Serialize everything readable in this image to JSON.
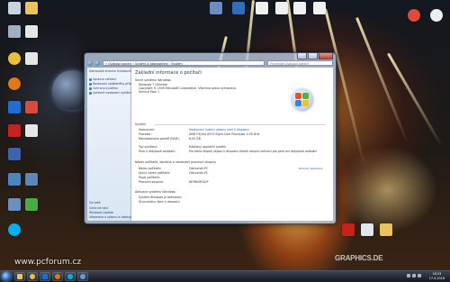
{
  "desktop": {
    "left_icons": [
      {
        "label": "Počítač",
        "color": "#c9d3df"
      },
      {
        "label": "Koš",
        "color": "#9fb0c4"
      },
      {
        "label": "Google Chrome",
        "color": "#e8c13a"
      },
      {
        "label": "Avast",
        "color": "#e0781c"
      },
      {
        "label": "Windows Media Player",
        "color": "#1d6ed8"
      },
      {
        "label": "CyberLink PowerDVD",
        "color": "#3a64b0"
      },
      {
        "label": "Adobe Reader",
        "color": "#c8221c"
      },
      {
        "label": "Network",
        "color": "#4b86c4"
      },
      {
        "label": "Remote",
        "color": "#6a90c0"
      },
      {
        "label": "Skype",
        "color": "#00aff0"
      }
    ],
    "right_icons": [
      {
        "label": "Folder",
        "color": "#e9c35d"
      },
      {
        "label": "Notes",
        "color": "#f0f0f0"
      },
      {
        "label": "Shortcut",
        "color": "#6a8ec4"
      },
      {
        "label": "Document",
        "color": "#f4f4f4"
      }
    ],
    "bottom_icons": [
      {
        "label": "Acrobat",
        "color": "#c8221c"
      },
      {
        "label": "Tool",
        "color": "#dfe6ee"
      },
      {
        "label": "Folder",
        "color": "#e9c35d"
      }
    ]
  },
  "window": {
    "address": "« Ovládací panely › Systém a zabezpečení › Systém",
    "search_placeholder": "Prohledat Ovládací panely",
    "left_pane": [
      "Domovská stránka Ovládacích panelů",
      "Správce zařízení",
      "Nastavení vzdáleného přístupu",
      "Ochrana systému",
      "Upřesnit nastavení systému"
    ],
    "left_pane_bottom_head": "Viz také",
    "left_pane_bottom": [
      "Centrum akcí",
      "Windows Update",
      "Informace o výkonu a nástroje"
    ],
    "title": "Základní informace o počítači",
    "edition_head": "Verze systému Windows",
    "edition": [
      "Windows 7 Ultimate",
      "Copyright © 2009 Microsoft Corporation. Všechna práva vyhrazena.",
      "Service Pack 1"
    ],
    "system_head": "Systém",
    "system_rows": [
      {
        "label": "Hodnocení:",
        "value": "Hodnocení indexu výkonu není k dispozici"
      },
      {
        "label": "Procesor:",
        "value": "AMD FX(tm)-8370 Eight-Core Processor       4.00 GHz"
      },
      {
        "label": "Nainstalovaná paměť (RAM):",
        "value": "8,00 GB"
      },
      {
        "label": "Typ systému:",
        "value": "64bitový operační systém"
      },
      {
        "label": "Pero a dotykové ovládání:",
        "value": "Pro tento displej nejsou k dispozici žádné vstupní zařízení pro pero ani dotykové ovládání"
      }
    ],
    "name_head": "Název počítače, doména a nastavení pracovní skupiny",
    "name_rows": [
      {
        "label": "Název počítače:",
        "value": "Ostrovnet-PC"
      },
      {
        "label": "Úplný název počítače:",
        "value": "Ostrovnet-PC"
      },
      {
        "label": "Popis počítače:",
        "value": ""
      },
      {
        "label": "Pracovní skupina:",
        "value": "WORKGROUP"
      }
    ],
    "change_settings": "Změnit nastavení",
    "activation_head": "Aktivace systému Windows",
    "activation_rows": [
      "Systém Windows je aktivován",
      "ID produktu: Není k dispozici"
    ]
  },
  "watermarks": {
    "left": "www.pcforum.cz",
    "right": "GRAPHICS.DE"
  },
  "taskbar": {
    "buttons": [
      {
        "name": "explorer",
        "color": "#e9c35d"
      },
      {
        "name": "chrome",
        "color": "#e8c13a"
      },
      {
        "name": "media",
        "color": "#1d6ed8"
      },
      {
        "name": "firefox",
        "color": "#e0781c"
      },
      {
        "name": "skype",
        "color": "#00aff0"
      },
      {
        "name": "ie",
        "color": "#5aa0e0"
      }
    ],
    "clock_time": "18:33",
    "clock_date": "17.4.2016"
  }
}
